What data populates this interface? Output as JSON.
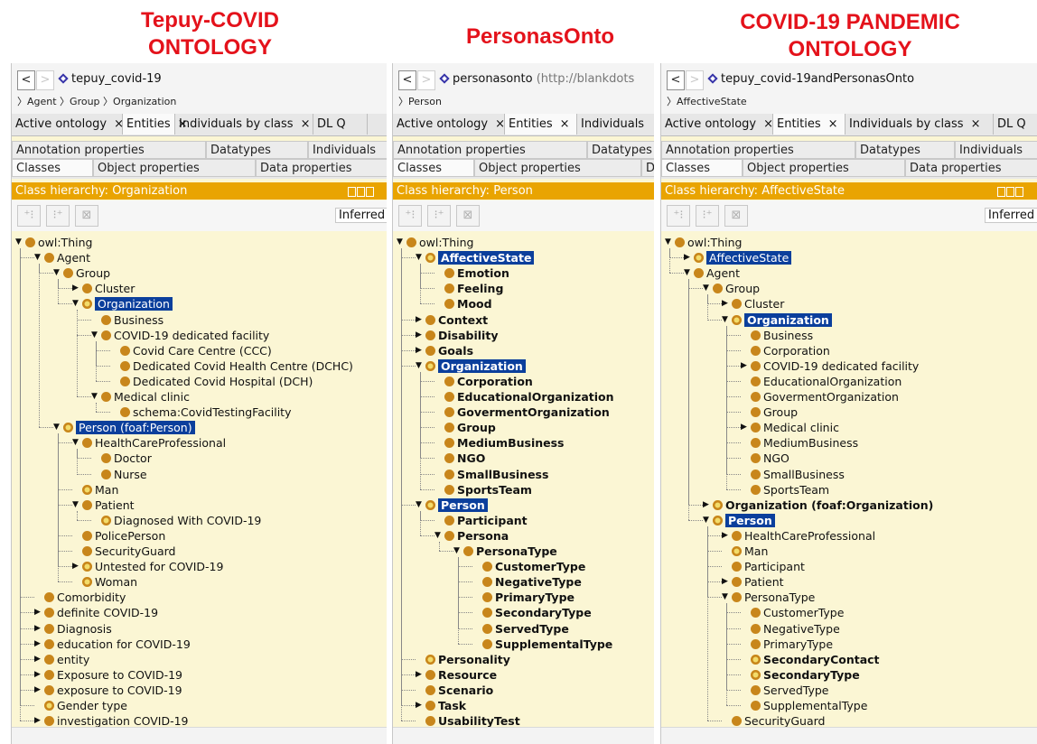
{
  "titles": [
    {
      "lines": [
        "Tepuy-COVID",
        "ONTOLOGY"
      ]
    },
    {
      "lines": [
        "PersonasOnto"
      ]
    },
    {
      "lines": [
        "COVID-19 PANDEMIC",
        "ONTOLOGY"
      ]
    }
  ],
  "panels": [
    {
      "ontology": "tepuy_covid-19",
      "iri": "",
      "breadcrumb": "〉Agent 〉Group 〉Organization",
      "tabs": [
        "Active ontology",
        "Entities",
        "Individuals by class",
        "DL Q"
      ],
      "active_tab": 1,
      "subtabs_row1": [
        "Annotation properties",
        "Datatypes",
        "Individuals"
      ],
      "subtabs_row2": [
        "Classes",
        "Object properties",
        "Data properties"
      ],
      "hierarchy_title": "Class hierarchy: Organization",
      "inferred": "Inferred",
      "tree": [
        {
          "label": "owl:Thing",
          "d": 0,
          "t": "open"
        },
        {
          "label": "Agent",
          "d": 1,
          "t": "open"
        },
        {
          "label": "Group",
          "d": 2,
          "t": "open"
        },
        {
          "label": "Cluster",
          "d": 3,
          "t": "closed"
        },
        {
          "label": "Organization",
          "d": 3,
          "t": "open",
          "sel": true,
          "def": true
        },
        {
          "label": "Business",
          "d": 4
        },
        {
          "label": "COVID-19 dedicated facility",
          "d": 4,
          "t": "open"
        },
        {
          "label": "Covid Care Centre (CCC)",
          "d": 5
        },
        {
          "label": "Dedicated Covid Health Centre (DCHC)",
          "d": 5
        },
        {
          "label": "Dedicated Covid Hospital (DCH)",
          "d": 5
        },
        {
          "label": "Medical clinic",
          "d": 4,
          "t": "open"
        },
        {
          "label": "schema:CovidTestingFacility",
          "d": 5
        },
        {
          "label": "Person (foaf:Person)",
          "d": 2,
          "t": "open",
          "sel": true,
          "def": true
        },
        {
          "label": "HealthCareProfessional",
          "d": 3,
          "t": "open"
        },
        {
          "label": "Doctor",
          "d": 4
        },
        {
          "label": "Nurse",
          "d": 4
        },
        {
          "label": "Man",
          "d": 3,
          "def": true
        },
        {
          "label": "Patient",
          "d": 3,
          "t": "open"
        },
        {
          "label": "Diagnosed With COVID-19",
          "d": 4,
          "def": true
        },
        {
          "label": "PolicePerson",
          "d": 3
        },
        {
          "label": "SecurityGuard",
          "d": 3
        },
        {
          "label": "Untested for COVID-19",
          "d": 3,
          "t": "closed",
          "def": true
        },
        {
          "label": "Woman",
          "d": 3,
          "def": true
        },
        {
          "label": "Comorbidity",
          "d": 1
        },
        {
          "label": "definite COVID-19",
          "d": 1,
          "t": "closed"
        },
        {
          "label": "Diagnosis",
          "d": 1,
          "t": "closed"
        },
        {
          "label": "education for COVID-19",
          "d": 1,
          "t": "closed"
        },
        {
          "label": "entity",
          "d": 1,
          "t": "closed"
        },
        {
          "label": "Exposure to COVID-19",
          "d": 1,
          "t": "closed"
        },
        {
          "label": "exposure to COVID-19",
          "d": 1,
          "t": "closed"
        },
        {
          "label": "Gender type",
          "d": 1,
          "def": true
        },
        {
          "label": "investigation COVID-19",
          "d": 1,
          "t": "closed"
        }
      ]
    },
    {
      "ontology": "personasonto",
      "iri": "(http://blankdots",
      "breadcrumb": "〉Person",
      "tabs": [
        "Active ontology",
        "Entities",
        "Individuals"
      ],
      "active_tab": 1,
      "subtabs_row1": [
        "Annotation properties",
        "Datatypes"
      ],
      "subtabs_row2": [
        "Classes",
        "Object properties",
        "D"
      ],
      "hierarchy_title": "Class hierarchy: Person",
      "inferred": "",
      "tree": [
        {
          "label": "owl:Thing",
          "d": 0,
          "t": "open"
        },
        {
          "label": "AffectiveState",
          "d": 1,
          "t": "open",
          "sel": true,
          "def": true,
          "b": true
        },
        {
          "label": "Emotion",
          "d": 2,
          "b": true
        },
        {
          "label": "Feeling",
          "d": 2,
          "b": true
        },
        {
          "label": "Mood",
          "d": 2,
          "b": true
        },
        {
          "label": "Context",
          "d": 1,
          "t": "closed",
          "b": true
        },
        {
          "label": "Disability",
          "d": 1,
          "t": "closed",
          "b": true
        },
        {
          "label": "Goals",
          "d": 1,
          "t": "closed",
          "b": true
        },
        {
          "label": "Organization",
          "d": 1,
          "t": "open",
          "sel": true,
          "def": true,
          "b": true
        },
        {
          "label": "Corporation",
          "d": 2,
          "b": true
        },
        {
          "label": "EducationalOrganization",
          "d": 2,
          "b": true
        },
        {
          "label": "GovermentOrganization",
          "d": 2,
          "b": true
        },
        {
          "label": "Group",
          "d": 2,
          "b": true
        },
        {
          "label": "MediumBusiness",
          "d": 2,
          "b": true
        },
        {
          "label": "NGO",
          "d": 2,
          "b": true
        },
        {
          "label": "SmallBusiness",
          "d": 2,
          "b": true
        },
        {
          "label": "SportsTeam",
          "d": 2,
          "b": true
        },
        {
          "label": "Person",
          "d": 1,
          "t": "open",
          "sel": true,
          "def": true,
          "b": true
        },
        {
          "label": "Participant",
          "d": 2,
          "b": true
        },
        {
          "label": "Persona",
          "d": 2,
          "t": "open",
          "b": true
        },
        {
          "label": "PersonaType",
          "d": 3,
          "t": "open",
          "b": true
        },
        {
          "label": "CustomerType",
          "d": 4,
          "b": true
        },
        {
          "label": "NegativeType",
          "d": 4,
          "b": true
        },
        {
          "label": "PrimaryType",
          "d": 4,
          "b": true
        },
        {
          "label": "SecondaryType",
          "d": 4,
          "b": true
        },
        {
          "label": "ServedType",
          "d": 4,
          "b": true
        },
        {
          "label": "SupplementalType",
          "d": 4,
          "b": true
        },
        {
          "label": "Personality",
          "d": 1,
          "def": true,
          "b": true
        },
        {
          "label": "Resource",
          "d": 1,
          "t": "closed",
          "b": true
        },
        {
          "label": "Scenario",
          "d": 1,
          "b": true
        },
        {
          "label": "Task",
          "d": 1,
          "t": "closed",
          "b": true
        },
        {
          "label": "UsabilityTest",
          "d": 1,
          "b": true
        }
      ]
    },
    {
      "ontology": "tepuy_covid-19andPersonasOnto",
      "iri": "",
      "breadcrumb": "〉AffectiveState",
      "tabs": [
        "Active ontology",
        "Entities",
        "Individuals by class",
        "DL Q"
      ],
      "active_tab": 1,
      "subtabs_row1": [
        "Annotation properties",
        "Datatypes",
        "Individuals"
      ],
      "subtabs_row2": [
        "Classes",
        "Object properties",
        "Data properties"
      ],
      "hierarchy_title": "Class hierarchy: AffectiveState",
      "inferred": "Inferred",
      "tree": [
        {
          "label": "owl:Thing",
          "d": 0,
          "t": "open"
        },
        {
          "label": "AffectiveState",
          "d": 1,
          "t": "closed",
          "sel": true,
          "def": true
        },
        {
          "label": "Agent",
          "d": 1,
          "t": "open"
        },
        {
          "label": "Group",
          "d": 2,
          "t": "open"
        },
        {
          "label": "Cluster",
          "d": 3,
          "t": "closed"
        },
        {
          "label": "Organization",
          "d": 3,
          "t": "open",
          "sel": true,
          "def": true,
          "b": true
        },
        {
          "label": "Business",
          "d": 4
        },
        {
          "label": "Corporation",
          "d": 4
        },
        {
          "label": "COVID-19 dedicated facility",
          "d": 4,
          "t": "closed"
        },
        {
          "label": "EducationalOrganization",
          "d": 4
        },
        {
          "label": "GovermentOrganization",
          "d": 4
        },
        {
          "label": "Group",
          "d": 4
        },
        {
          "label": "Medical clinic",
          "d": 4,
          "t": "closed"
        },
        {
          "label": "MediumBusiness",
          "d": 4
        },
        {
          "label": "NGO",
          "d": 4
        },
        {
          "label": "SmallBusiness",
          "d": 4
        },
        {
          "label": "SportsTeam",
          "d": 4
        },
        {
          "label": "Organization (foaf:Organization)",
          "d": 2,
          "t": "closed",
          "def": true,
          "b": true
        },
        {
          "label": "Person",
          "d": 2,
          "t": "open",
          "sel": true,
          "def": true,
          "b": true
        },
        {
          "label": "HealthCareProfessional",
          "d": 3,
          "t": "closed"
        },
        {
          "label": "Man",
          "d": 3,
          "def": true
        },
        {
          "label": "Participant",
          "d": 3
        },
        {
          "label": "Patient",
          "d": 3,
          "t": "closed"
        },
        {
          "label": "PersonaType",
          "d": 3,
          "t": "open"
        },
        {
          "label": "CustomerType",
          "d": 4
        },
        {
          "label": "NegativeType",
          "d": 4
        },
        {
          "label": "PrimaryType",
          "d": 4
        },
        {
          "label": "SecondaryContact",
          "d": 4,
          "def": true,
          "b": true
        },
        {
          "label": "SecondaryType",
          "d": 4,
          "def": true,
          "b": true
        },
        {
          "label": "ServedType",
          "d": 4
        },
        {
          "label": "SupplementalType",
          "d": 4
        },
        {
          "label": "SecurityGuard",
          "d": 3
        }
      ]
    }
  ]
}
